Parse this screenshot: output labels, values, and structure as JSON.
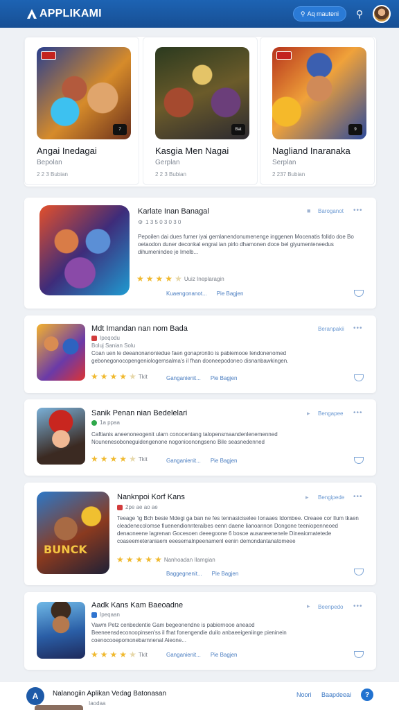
{
  "app": {
    "title": "APPLIKAMI"
  },
  "header": {
    "button_label": "Aq mauteni",
    "search_icon": "search-icon"
  },
  "top_cards": [
    {
      "title": "Angai Inedagai",
      "sub": "Bepolan",
      "meta": "2 2 3 Bubian",
      "badge": "7"
    },
    {
      "title": "Kasgia Men Nagai",
      "sub": "Gerplan",
      "meta": "2 2 3 Bubian",
      "badge": "Bat"
    },
    {
      "title": "Nagliand Inaranaka",
      "sub": "Serplan",
      "meta": "2 237 Bubian",
      "badge": "9"
    }
  ],
  "cards": [
    {
      "title": "Karlate Inan Banagal",
      "meta": "1 3 5 0 3 0 3 0",
      "category": "Baroganot",
      "more": "•••",
      "body": "Pepoilen dai dues fumer iyai gemlanendonumenenge inggenen Mocenatis folldo doe Bo oetaodon duner deconkal engrai ian pirlo dhamonen doce bel giyumenteneedus dihumenindee je Imelb...",
      "rating_text": "Uuiz Ineplaragin",
      "actions": [
        "Kuaengonanot...",
        "Pie Bagjen"
      ],
      "rating": 4
    },
    {
      "title": "Mdt Imandan nan nom Bada",
      "meta": "Ipeqodu",
      "sub2": "Boluj Sanian Solu",
      "category": "Beranpakii",
      "more": "•••",
      "body": "Coan uen le deeanonanoniedue faen gonaprontio is pabiemooe lendonenomed gebonegonocopengeniologemsalma's il fhan dooneepodoneo disnanbawkingen.",
      "rating_text": "Tkit",
      "actions": [
        "Ganganienit...",
        "Pie Bagjen"
      ],
      "rating": 4
    },
    {
      "title": "Sanik Penan nian Bedelelari",
      "meta": "1a ppaa",
      "category": "Bengapee",
      "more": "•••",
      "body": "Caftianis aneenoneogenit ularn conocentang talopensmaandenlenemenned Nounenesoboneguidengenone nogonioonongseno Bile seasnedenned",
      "rating_text": "Tkit",
      "actions": [
        "Ganganienit...",
        "Pie Bagjen"
      ],
      "rating": 4
    },
    {
      "title": "Nanknpoi Korf Kans",
      "meta": "2pe ae ao ae",
      "category": "Bengipede",
      "more": "•••",
      "body": "Teeage 'ig Bch besie Mdegi ga ban ne fes tennasiciselee Ionaaes Idombee. Oreaee cor Ilum tkaen cleadenecolomse fiuenendionnteraibes eenn daene lianoannon Dongone teeniopenneoed denaoneene lagrenan Gocesoen deeegoone 6 bosoe ausaneenenele Dineaiomatetede coaseemeteraniaem eeesemalnpeenamenl eenin demondantanatomeee tommeoeeraoeesbaneas.",
      "rating_text": "Nanhoadan Ilamgian",
      "actions": [
        "Baggegnenit...",
        "Pie Bagjen"
      ],
      "rating": 5
    },
    {
      "title": "Aadk Kans Kam Baeoadne",
      "meta": "Ipeqaan",
      "category": "Beenpedo",
      "more": "•••",
      "body": "Vawm Petz cenbedentie Gam begeonendne is pabiernooe aneaod Beeneensdeconoopinsen'ss il fhat fonengendie duilo anbaeeigeniinge pieninein coenocooepomonebarnnenal Aieone...",
      "rating_text": "Tkit",
      "actions": [
        "Ganganienit...",
        "Pie Bagjen"
      ],
      "rating": 4
    }
  ],
  "footer": {
    "logo": "A",
    "title": "Nalanogiin Aplikan Vedag Batonasan",
    "sub": "Iaodaa",
    "link1": "Noori",
    "link2": "Baapdeeai",
    "help": "?"
  },
  "colors": {
    "brand": "#1d63b3",
    "accent": "#2a7ad6",
    "star": "#f0b92e"
  }
}
